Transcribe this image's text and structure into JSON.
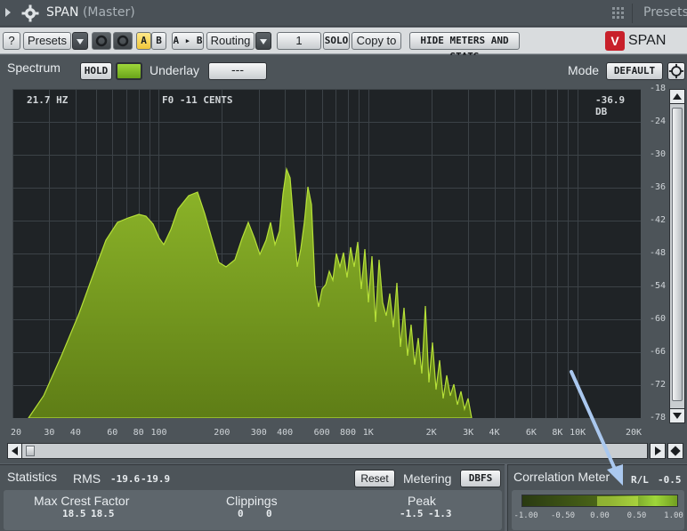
{
  "window": {
    "title": "SPAN",
    "subtitle": "(Master)",
    "presets_label": "Presets"
  },
  "toolbar": {
    "help_label": "?",
    "presets_label": "Presets",
    "a_label": "A",
    "b_label": "B",
    "a_to_b_label": "A ▸ B",
    "routing_label": "Routing",
    "channel_value": "1",
    "solo_label": "SOLO",
    "copy_to_label": "Copy to",
    "hide_meters_label": "HIDE METERS AND STATS",
    "logo_mark": "V",
    "logo_text": "SPAN"
  },
  "spectrum": {
    "tab_label": "Spectrum",
    "hold_label": "HOLD",
    "underlay_label": "Underlay",
    "underlay_value": "---",
    "mode_label": "Mode",
    "mode_value": "DEFAULT",
    "readout_freq": "21.7 HZ",
    "readout_note": "F0  -11 CENTS",
    "readout_db": "-36.9 DB",
    "db_ticks": [
      "-18",
      "-24",
      "-30",
      "-36",
      "-42",
      "-48",
      "-54",
      "-60",
      "-66",
      "-72",
      "-78"
    ],
    "freq_ticks": [
      "20",
      "30",
      "40",
      "60",
      "80",
      "100",
      "200",
      "300",
      "400",
      "600",
      "800",
      "1K",
      "2K",
      "3K",
      "4K",
      "6K",
      "8K",
      "10K",
      "20K"
    ],
    "fill_color": "#8fb82a"
  },
  "statistics": {
    "tab_label": "Statistics",
    "rms_label": "RMS",
    "rms_left": "-19.6",
    "rms_right": "-19.9",
    "reset_label": "Reset",
    "metering_label": "Metering",
    "metering_value": "DBFS",
    "max_crest_label": "Max Crest Factor",
    "max_crest_left": "18.5",
    "max_crest_right": "18.5",
    "clippings_label": "Clippings",
    "clippings_left": "0",
    "clippings_right": "0",
    "peak_label": "Peak",
    "peak_left": "-1.5",
    "peak_right": "-1.3"
  },
  "correlation": {
    "tab_label": "Correlation Meter",
    "rl_label": "R/L",
    "rl_value": "-0.5",
    "ticks": [
      "-1.00",
      "-0.50",
      "0.00",
      "0.50",
      "1.00"
    ]
  }
}
